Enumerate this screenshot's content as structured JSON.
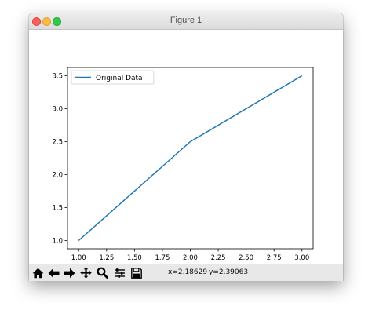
{
  "window": {
    "title": "Figure 1"
  },
  "toolbar": {
    "buttons": [
      {
        "name": "home-icon"
      },
      {
        "name": "back-arrow-icon"
      },
      {
        "name": "forward-arrow-icon"
      },
      {
        "name": "pan-move-icon"
      },
      {
        "name": "zoom-magnifier-icon"
      },
      {
        "name": "configure-subplots-icon"
      },
      {
        "name": "save-floppy-icon"
      }
    ],
    "x_readout": "x=2.18629",
    "y_readout": "y=2.39063"
  },
  "colors": {
    "line": "#1f77b4",
    "axes": "#000000"
  },
  "chart_data": {
    "type": "line",
    "x": [
      1.0,
      2.0,
      3.0
    ],
    "series": [
      {
        "name": "Original Data",
        "values": [
          1.0,
          2.5,
          3.5
        ]
      }
    ],
    "xlim": [
      0.9,
      3.1
    ],
    "ylim": [
      0.875,
      3.625
    ],
    "xticks": [
      1.0,
      1.25,
      1.5,
      1.75,
      2.0,
      2.25,
      2.5,
      2.75,
      3.0
    ],
    "xtick_labels": [
      "1.00",
      "1.25",
      "1.50",
      "1.75",
      "2.00",
      "2.25",
      "2.50",
      "2.75",
      "3.00"
    ],
    "yticks": [
      1.0,
      1.5,
      2.0,
      2.5,
      3.0,
      3.5
    ],
    "ytick_labels": [
      "1.0",
      "1.5",
      "2.0",
      "2.5",
      "3.0",
      "3.5"
    ],
    "grid": false,
    "legend_position": "top-left",
    "title": "",
    "xlabel": "",
    "ylabel": ""
  }
}
